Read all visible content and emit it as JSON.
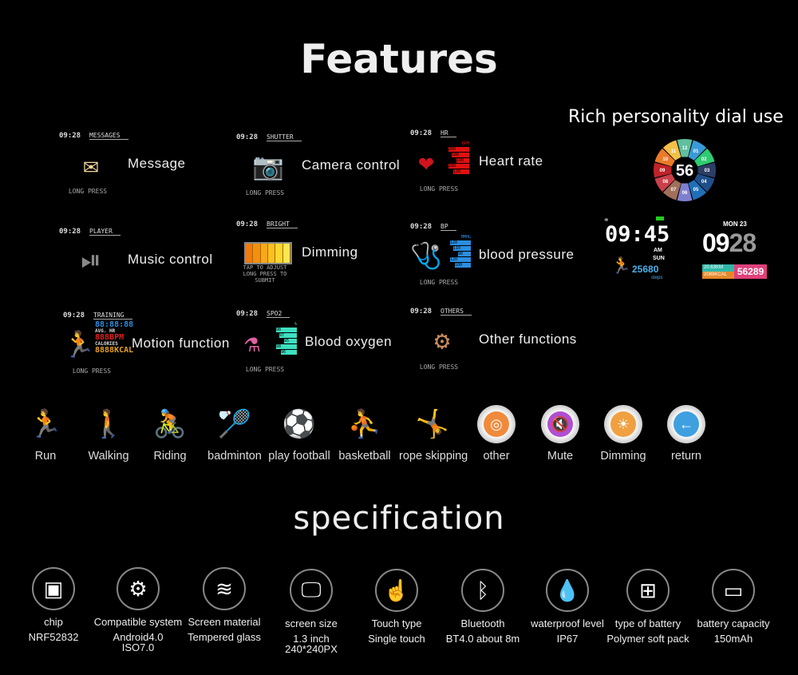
{
  "header": {
    "title": "Features"
  },
  "features": [
    {
      "time": "09:28",
      "screen": "MESSAGES",
      "hint": "LONG PRESS",
      "label": "Message",
      "icon": "envelope-icon"
    },
    {
      "time": "09:28",
      "screen": "SHUTTER",
      "hint": "LONG PRESS",
      "label": "Camera control",
      "icon": "camera-icon"
    },
    {
      "time": "09:28",
      "screen": "HR",
      "hint": "LONG PRESS",
      "label": "Heart rate",
      "icon": "heart-icon",
      "unit": "BPM",
      "values": [
        "200",
        "180",
        "100",
        "180",
        "120"
      ]
    },
    {
      "time": "09:28",
      "screen": "PLAYER",
      "hint": "",
      "label": "Music control",
      "icon": "player-icon"
    },
    {
      "time": "09:28",
      "screen": "BRIGHT",
      "hint": "TAP TO ADJUST\nLONG PRESS TO SUBMIT",
      "label": "Dimming",
      "icon": "brightness-bar-icon"
    },
    {
      "time": "09:28",
      "screen": "BP",
      "hint": "LONG PRESS",
      "label": "blood pressure",
      "icon": "blood-pressure-icon",
      "unit": "MMHG",
      "values": [
        "120",
        "110",
        "90",
        "120",
        "100"
      ]
    },
    {
      "time": "09:28",
      "screen": "TRAINING",
      "hint": "LONG PRESS",
      "label": "Motion function",
      "icon": "runners-icon",
      "stats": [
        "88:88:88",
        "AVG. HR",
        "888BPM",
        "CALORIES",
        "8888KCAL"
      ]
    },
    {
      "time": "09:28",
      "screen": "SPO2",
      "hint": "LONG PRESS",
      "label": "Blood oxygen",
      "icon": "flask-icon",
      "unit": "%",
      "values": [
        "98",
        "97",
        "95",
        "98",
        "96"
      ]
    },
    {
      "time": "09:28",
      "screen": "OTHERS",
      "hint": "LONG PRESS",
      "label": "Other functions",
      "icon": "gear-clock-icon"
    }
  ],
  "dials": {
    "title": "Rich personality dial use",
    "wheel": {
      "center": "56",
      "hours": [
        "12",
        "01",
        "02",
        "03",
        "04",
        "05",
        "06",
        "07",
        "08",
        "09",
        "10",
        "11"
      ],
      "colors": [
        "#5fbf9f",
        "#3a9ad9",
        "#2ecc71",
        "#2c3e66",
        "#1f4f8a",
        "#1e6fb8",
        "#7f7fd0",
        "#a0705a",
        "#c9404a",
        "#c0222a",
        "#e97a28",
        "#f3c04a"
      ]
    },
    "face1": {
      "time": "09:45",
      "ampm": "AM",
      "day": "SUN",
      "steps": "25680",
      "steps_label": "steps"
    },
    "face2": {
      "date": "MON 23",
      "hour": "09",
      "minute": "28",
      "distance": "20.63KM",
      "calories": "2089KCAL",
      "total": "56289"
    }
  },
  "sports": [
    {
      "label": "Run",
      "icon": "running-icon"
    },
    {
      "label": "Walking",
      "icon": "walking-icon"
    },
    {
      "label": "Riding",
      "icon": "cycling-icon"
    },
    {
      "label": "badminton",
      "icon": "badminton-icon"
    },
    {
      "label": "play football",
      "icon": "football-icon"
    },
    {
      "label": "basketball",
      "icon": "basketball-icon"
    },
    {
      "label": "rope skipping",
      "icon": "rope-skipping-icon"
    },
    {
      "label": "other",
      "icon": "other-icon",
      "color": "#f08a3c"
    },
    {
      "label": "Mute",
      "icon": "mute-icon",
      "color": "#b04fd0"
    },
    {
      "label": "Dimming",
      "icon": "sun-icon",
      "color": "#f0a040"
    },
    {
      "label": "return",
      "icon": "return-icon",
      "color": "#3fa0e0"
    }
  ],
  "spec": {
    "title": "specification",
    "items": [
      {
        "label": "chip",
        "value": "NRF52832",
        "icon": "chip-icon"
      },
      {
        "label": "Compatible system",
        "value": "Android4.0\nISO7.0",
        "icon": "gear-icon"
      },
      {
        "label": "Screen material",
        "value": "Tempered glass",
        "icon": "layers-icon"
      },
      {
        "label": "screen size",
        "value": "1.3 inch\n240*240PX",
        "icon": "monitor-icon"
      },
      {
        "label": "Touch type",
        "value": "Single touch",
        "icon": "hand-pointer-icon"
      },
      {
        "label": "Bluetooth",
        "value": "BT4.0  about 8m",
        "icon": "bluetooth-icon"
      },
      {
        "label": "waterproof level",
        "value": "IP67",
        "icon": "water-drop-icon"
      },
      {
        "label": "type of battery",
        "value": "Polymer soft pack",
        "icon": "car-battery-icon"
      },
      {
        "label": "battery capacity",
        "value": "150mAh",
        "icon": "battery-icon"
      }
    ]
  }
}
